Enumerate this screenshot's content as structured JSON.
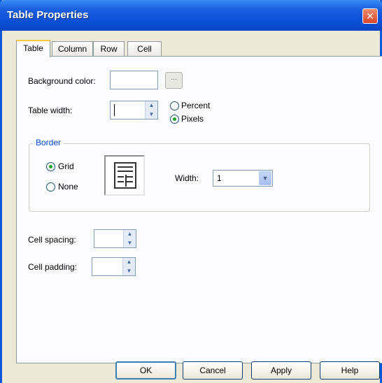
{
  "window": {
    "title": "Table Properties",
    "close_glyph": "✕"
  },
  "tabs": [
    {
      "label": "Table",
      "active": true
    },
    {
      "label": "Column",
      "active": false
    },
    {
      "label": "Row",
      "active": false
    },
    {
      "label": "Cell",
      "active": false
    }
  ],
  "table": {
    "background_color_label": "Background color:",
    "background_color_value": "",
    "browse_label": "...",
    "table_width_label": "Table width:",
    "table_width_value": "",
    "unit_options": [
      {
        "label": "Percent",
        "checked": false
      },
      {
        "label": "Pixels",
        "checked": true
      }
    ]
  },
  "border": {
    "legend": "Border",
    "options": [
      {
        "label": "Grid",
        "checked": true
      },
      {
        "label": "None",
        "checked": false
      }
    ],
    "width_label": "Width:",
    "width_value": "1"
  },
  "spacing": {
    "cell_spacing_label": "Cell spacing:",
    "cell_spacing_value": "",
    "cell_padding_label": "Cell padding:",
    "cell_padding_value": ""
  },
  "buttons": {
    "ok": "OK",
    "cancel": "Cancel",
    "apply": "Apply",
    "help": "Help"
  },
  "colors": {
    "titlebar": "#0a4fd6",
    "group_legend": "#0046d5",
    "radio_checked": "#21a121",
    "active_tab_highlight": "#ffc83c"
  }
}
